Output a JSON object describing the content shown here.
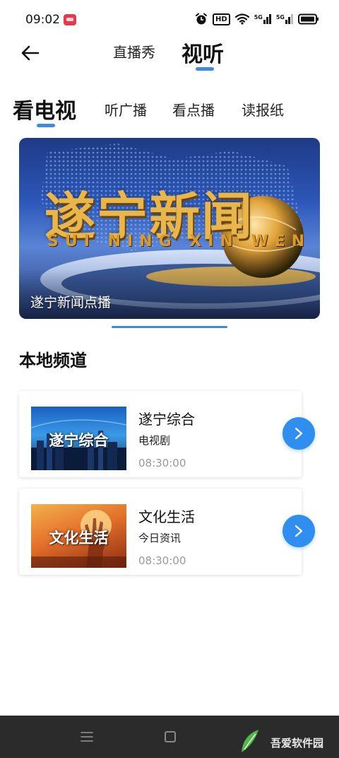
{
  "status_bar": {
    "time": "09:02",
    "hd_label": "HD",
    "net_label_1": "5G",
    "net_label_2": "5G",
    "icons": [
      "app-notification-icon",
      "alarm-icon",
      "hd-icon",
      "wifi-icon",
      "signal-5g-icon",
      "signal-5g-icon",
      "battery-icon"
    ]
  },
  "header": {
    "back_icon": "back-arrow-icon",
    "tabs": [
      {
        "label": "直播秀"
      },
      {
        "label": "视听"
      }
    ],
    "accent_color": "#3b8be0"
  },
  "sub_tabs": [
    {
      "label": "看电视"
    },
    {
      "label": "听广播"
    },
    {
      "label": "看点播"
    },
    {
      "label": "读报纸"
    }
  ],
  "banner": {
    "title": "遂宁新闻",
    "pinyin": "SUI NING XIN WEN",
    "caption": "遂宁新闻点播"
  },
  "section": {
    "title": "本地频道"
  },
  "channels": [
    {
      "thumb_text": "遂宁综合",
      "name": "遂宁综合",
      "category": "电视剧",
      "time": "08:30:00"
    },
    {
      "thumb_text": "文化生活",
      "name": "文化生活",
      "category": "今日资讯",
      "time": "08:30:00"
    }
  ],
  "nav_bar": {
    "icons": [
      "menu-icon",
      "home-icon"
    ],
    "watermark_text": "吾爱软件园"
  }
}
